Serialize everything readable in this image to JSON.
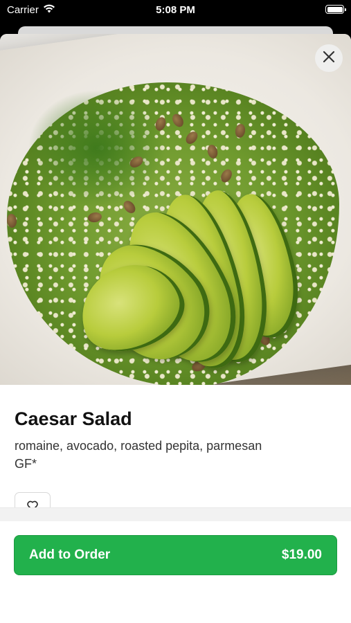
{
  "status_bar": {
    "carrier": "Carrier",
    "time": "5:08 PM"
  },
  "item": {
    "title": "Caesar Salad",
    "description": "romaine, avocado, roasted pepita, parmesan",
    "dietary_tag": "GF*",
    "image_alt": "Caesar Salad photo"
  },
  "actions": {
    "add_label": "Add to Order",
    "price": "$19.00"
  },
  "icons": {
    "close": "close-icon",
    "favorite": "heart-icon",
    "wifi": "wifi-icon",
    "battery": "battery-icon"
  },
  "colors": {
    "accent": "#22b14c",
    "background": "#ffffff"
  }
}
